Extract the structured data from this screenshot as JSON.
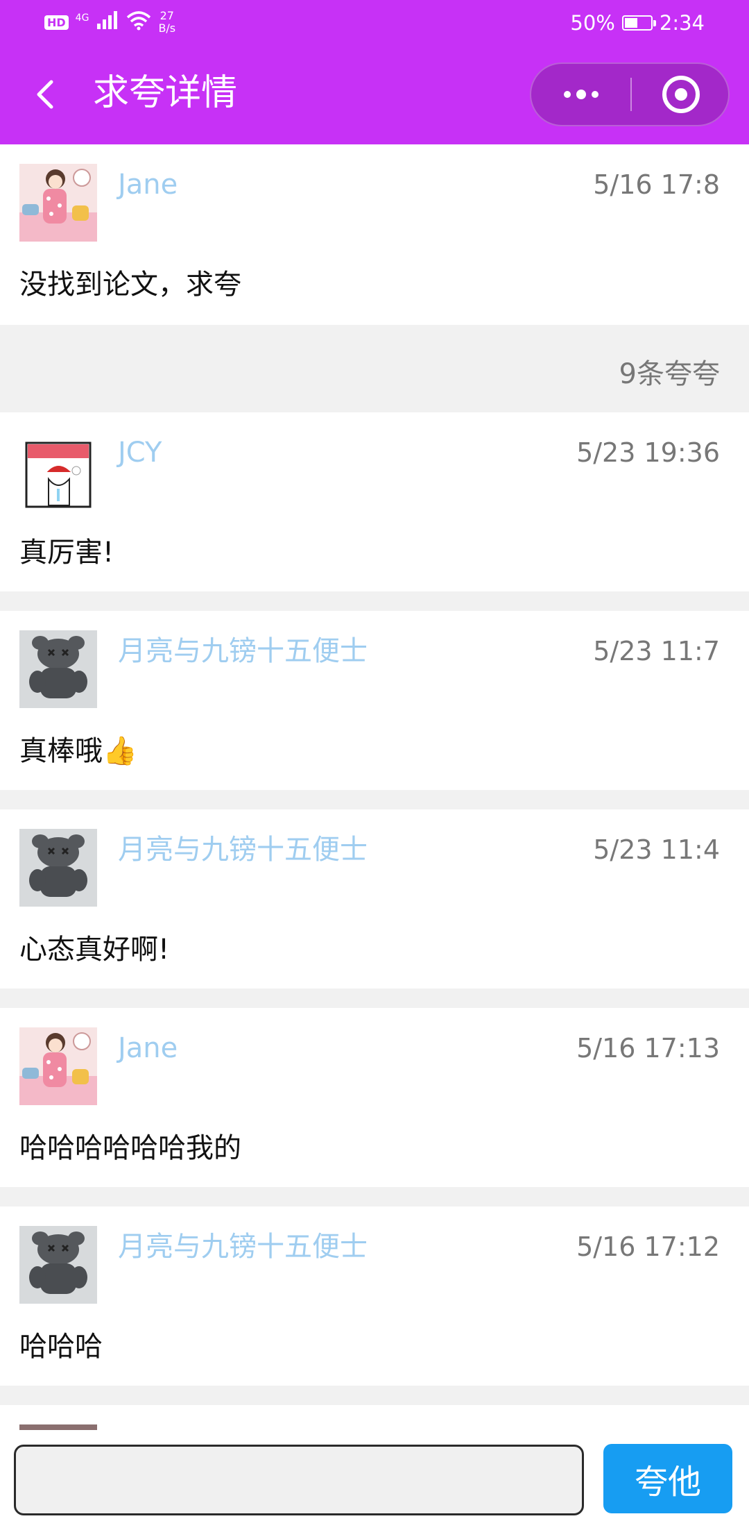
{
  "status_bar": {
    "hd": "HD",
    "network": "4G",
    "speed_value": "27",
    "speed_unit": "B/s",
    "battery": "50%",
    "battery_level": 0.5,
    "time": "2:34"
  },
  "nav": {
    "title": "求夸详情",
    "icons": {
      "back": "chevron-left-icon",
      "more": "more-dots-icon",
      "close": "target-close-icon"
    }
  },
  "post": {
    "author": "Jane",
    "time": "5/16 17:8",
    "content": "没找到论文，求夸"
  },
  "reply_count": "9条夸夸",
  "replies": [
    {
      "author": "JCY",
      "time": "5/23 19:36",
      "content": "真厉害!",
      "avatar": "sad-santa-avatar"
    },
    {
      "author": "月亮与九镑十五便士",
      "time": "5/23 11:7",
      "content": "真棒哦👍",
      "avatar": "kaws-figure-avatar"
    },
    {
      "author": "月亮与九镑十五便士",
      "time": "5/23 11:4",
      "content": "心态真好啊!",
      "avatar": "kaws-figure-avatar"
    },
    {
      "author": "Jane",
      "time": "5/16 17:13",
      "content": "哈哈哈哈哈哈我的",
      "avatar": "girl-pajama-avatar"
    },
    {
      "author": "月亮与九镑十五便士",
      "time": "5/16 17:12",
      "content": "哈哈哈",
      "avatar": "kaws-figure-avatar"
    }
  ],
  "composer": {
    "placeholder": "",
    "send_label": "夸他"
  },
  "colors": {
    "header": "#c731f6",
    "name": "#9fcdf0",
    "send_button": "#179df2"
  }
}
